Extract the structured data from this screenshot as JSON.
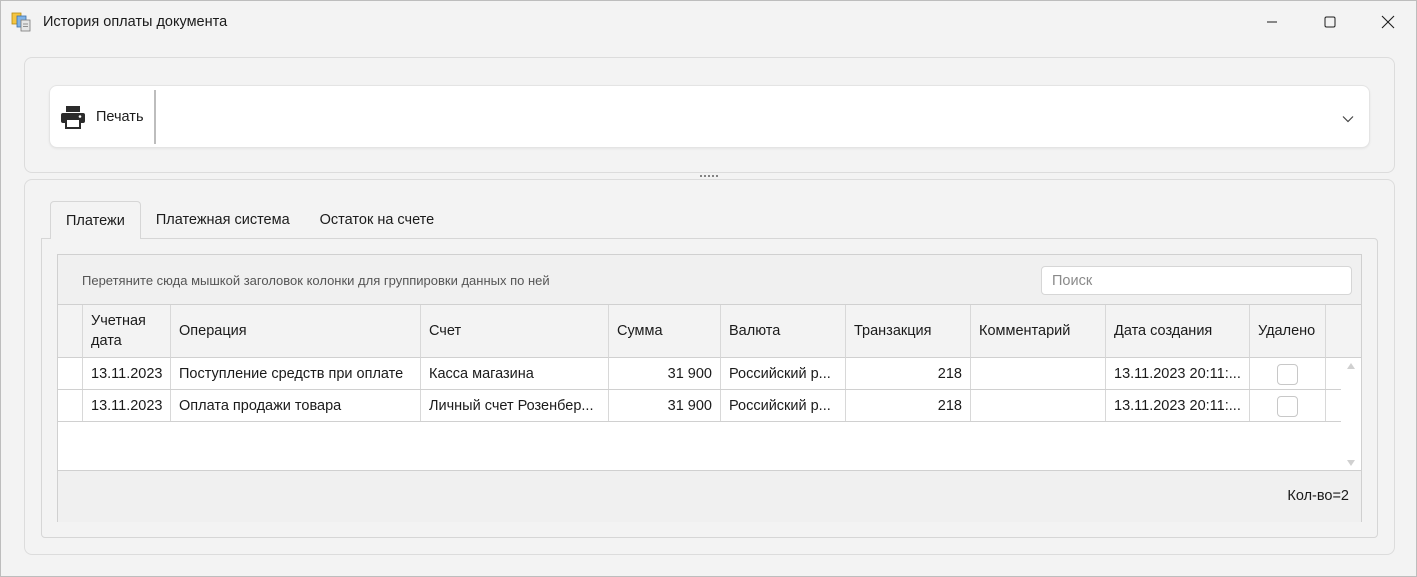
{
  "window": {
    "title": "История оплаты документа",
    "app_icon": "documents-app-icon",
    "controls": [
      "minimize-icon",
      "maximize-icon",
      "close-icon"
    ]
  },
  "toolbar": {
    "print_label": "Печать",
    "print_icon": "printer-icon",
    "expand_icon": "chevron-down-icon"
  },
  "tabs": [
    {
      "label": "Платежи",
      "active": true
    },
    {
      "label": "Платежная система",
      "active": false
    },
    {
      "label": "Остаток на счете",
      "active": false
    }
  ],
  "grid": {
    "group_hint": "Перетяните сюда мышкой заголовок колонки для группировки данных по ней",
    "search_placeholder": "Поиск",
    "columns": [
      "Учетная дата",
      "Операция",
      "Счет",
      "Сумма",
      "Валюта",
      "Транзакция",
      "Комментарий",
      "Дата создания",
      "Удалено"
    ],
    "rows": [
      {
        "date": "13.11.2023",
        "operation": "Поступление средств при оплате",
        "account": "Касса магазина",
        "amount": "31 900",
        "currency": "Российский р...",
        "transaction": "218",
        "comment": "",
        "created": "13.11.2023 20:11:...",
        "deleted": false
      },
      {
        "date": "13.11.2023",
        "operation": "Оплата продажи товара",
        "account": "Личный счет Розенбер...",
        "amount": "31 900",
        "currency": "Российский р...",
        "transaction": "218",
        "comment": "",
        "created": "13.11.2023 20:11:...",
        "deleted": false
      }
    ],
    "count_label": "Кол-во=2"
  }
}
